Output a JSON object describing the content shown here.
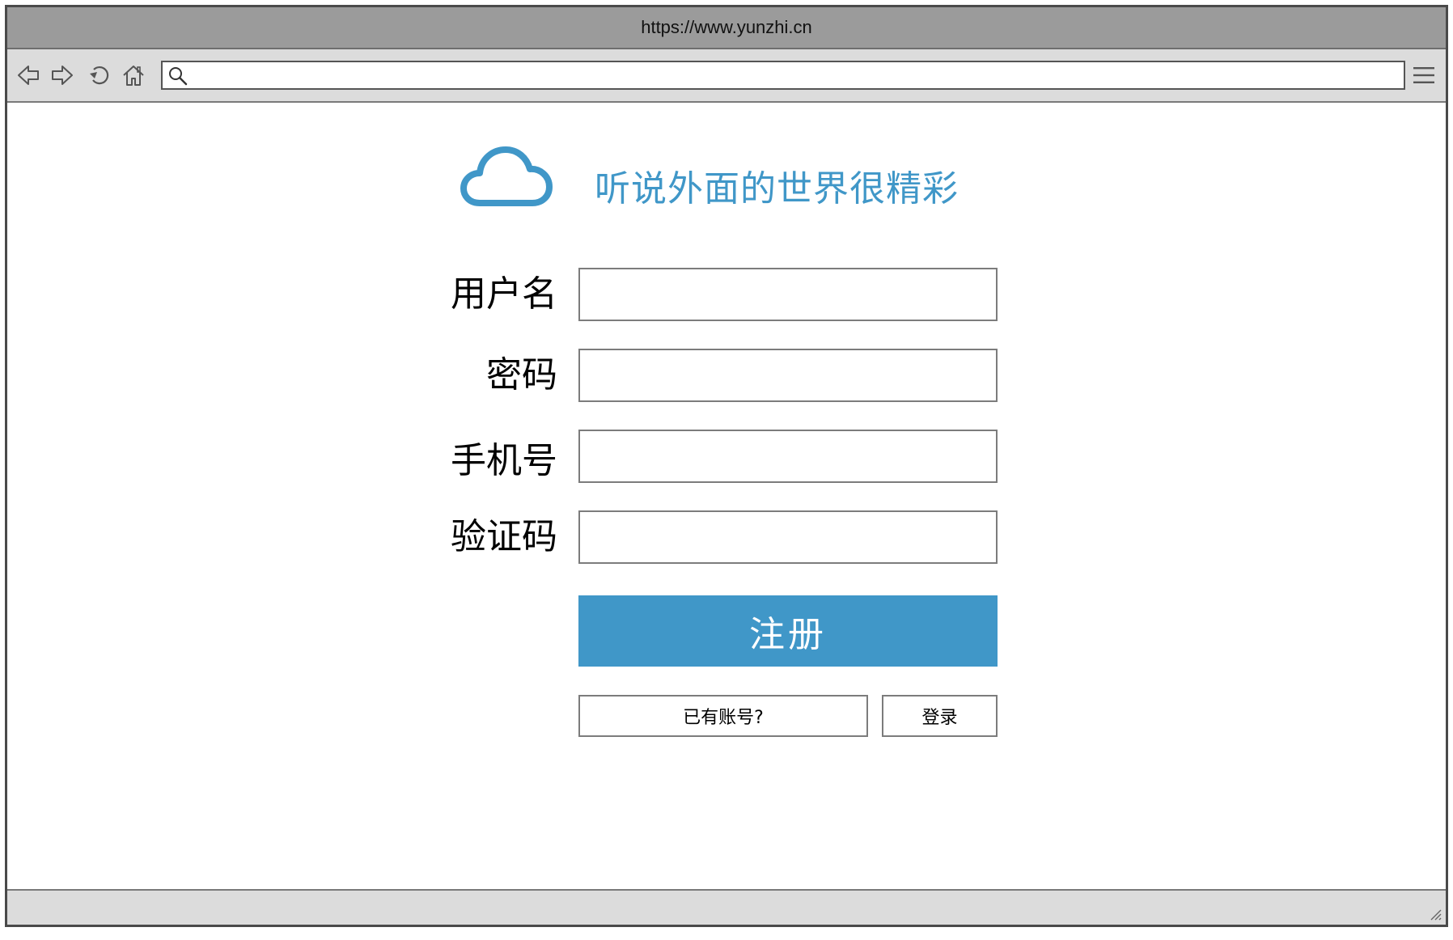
{
  "window": {
    "url": "https://www.yunzhi.cn"
  },
  "toolbar": {
    "icons": [
      "back-icon",
      "forward-icon",
      "refresh-icon",
      "home-icon",
      "search-icon",
      "menu-icon"
    ],
    "address_value": "",
    "border_color": "#555555"
  },
  "brand": {
    "logo_icon": "cloud-icon",
    "slogan": "听说外面的世界很精彩"
  },
  "form": {
    "fields": [
      {
        "label": "用户名",
        "value": ""
      },
      {
        "label": "密码",
        "value": ""
      },
      {
        "label": "手机号",
        "value": ""
      },
      {
        "label": "验证码",
        "value": ""
      }
    ],
    "submit_label": "注册",
    "has_account_label": "已有账号?",
    "login_label": "登录"
  },
  "colors": {
    "accent": "#4097c8",
    "frame": "#4a4a4a",
    "titlebar": "#9b9b9b",
    "toolbar": "#dcdcdc"
  }
}
